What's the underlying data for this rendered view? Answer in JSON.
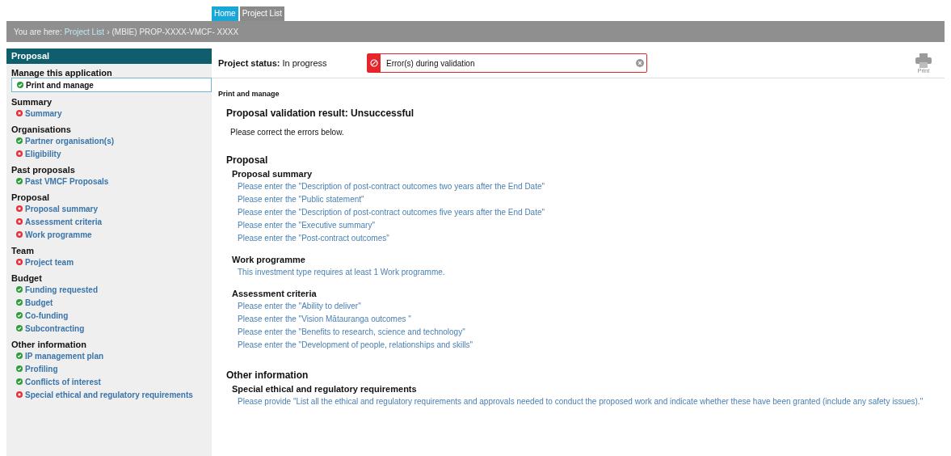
{
  "nav_tabs": [
    {
      "label": "Home",
      "selected": true
    },
    {
      "label": "Project List",
      "selected": false
    }
  ],
  "breadcrumb": {
    "prefix": "You are here:",
    "link": "Project List",
    "separator": "›",
    "current": "(MBIE) PROP-XXXX-VMCF- XXXX"
  },
  "sidebar": {
    "title": "Proposal",
    "groups": [
      {
        "heading": "Manage this application",
        "items": [
          {
            "label": "Print and manage",
            "valid": true,
            "selected": true
          }
        ]
      },
      {
        "heading": "Summary",
        "items": [
          {
            "label": "Summary",
            "valid": false,
            "selected": false
          }
        ]
      },
      {
        "heading": "Organisations",
        "items": [
          {
            "label": "Partner organisation(s)",
            "valid": true,
            "selected": false
          },
          {
            "label": "Eligibility",
            "valid": false,
            "selected": false
          }
        ]
      },
      {
        "heading": "Past proposals",
        "items": [
          {
            "label": "Past VMCF Proposals",
            "valid": true,
            "selected": false
          }
        ]
      },
      {
        "heading": "Proposal",
        "items": [
          {
            "label": "Proposal summary",
            "valid": false,
            "selected": false
          },
          {
            "label": "Assessment criteria",
            "valid": false,
            "selected": false
          },
          {
            "label": "Work programme",
            "valid": false,
            "selected": false
          }
        ]
      },
      {
        "heading": "Team",
        "items": [
          {
            "label": "Project team",
            "valid": false,
            "selected": false
          }
        ]
      },
      {
        "heading": "Budget",
        "items": [
          {
            "label": "Funding requested",
            "valid": true,
            "selected": false
          },
          {
            "label": "Budget",
            "valid": true,
            "selected": false
          },
          {
            "label": "Co-funding",
            "valid": true,
            "selected": false
          },
          {
            "label": "Subcontracting",
            "valid": true,
            "selected": false
          }
        ]
      },
      {
        "heading": "Other information",
        "items": [
          {
            "label": "IP management plan",
            "valid": true,
            "selected": false
          },
          {
            "label": "Profiling",
            "valid": true,
            "selected": false
          },
          {
            "label": "Conflicts of interest",
            "valid": true,
            "selected": false
          },
          {
            "label": "Special ethical and regulatory requirements",
            "valid": false,
            "selected": false
          }
        ]
      }
    ]
  },
  "project_status": {
    "label": "Project status:",
    "value": "In progress"
  },
  "alert": {
    "message": "Error(s) during validation"
  },
  "print_button": {
    "label": "Print"
  },
  "page_title": "Print and manage",
  "result": {
    "heading": "Proposal validation result: Unsuccessful",
    "note": "Please correct the errors below."
  },
  "sections": [
    {
      "heading": "Proposal",
      "subsections": [
        {
          "heading": "Proposal summary",
          "messages": [
            "Please enter the \"Description of post-contract outcomes two years after the End Date\"",
            "Please enter the \"Public statement\"",
            "Please enter the \"Description of post-contract outcomes five years after the End Date\"",
            "Please enter the \"Executive summary\"",
            "Please enter the \"Post-contract outcomes\""
          ]
        },
        {
          "heading": "Work programme",
          "messages": [
            "This investment type requires at least 1 Work programme."
          ]
        },
        {
          "heading": "Assessment criteria",
          "messages": [
            "Please enter the \"Ability to deliver\"",
            "Please enter the \"Vision Mātauranga outcomes \"",
            "Please enter the \"Benefits to research, science and technology\"",
            "Please enter the \"Development of people, relationships and skills\""
          ]
        }
      ]
    },
    {
      "heading": "Other information",
      "subsections": [
        {
          "heading": "Special ethical and regulatory requirements",
          "messages": [
            "Please provide \"List all the ethical and regulatory requirements and approvals needed to conduct the proposed work and indicate whether these have been granted (include any safety issues).\""
          ]
        }
      ]
    }
  ]
}
